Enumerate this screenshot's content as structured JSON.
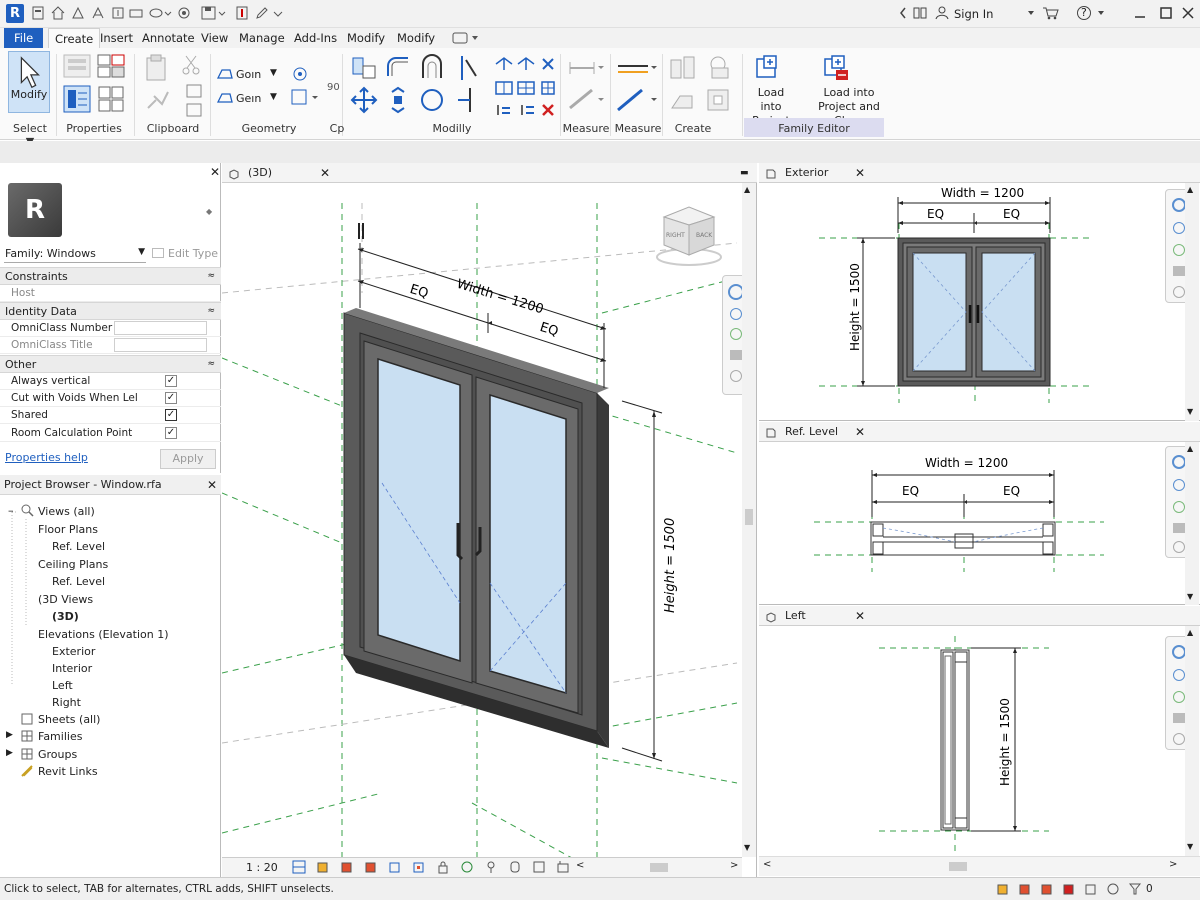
{
  "quick_access": {
    "sign_in": "Sign In",
    "help": "?"
  },
  "menu": {
    "file": "File",
    "tabs": [
      "Create",
      "Insert",
      "Annotate",
      "View",
      "Manage",
      "Add-Ins",
      "Modify",
      "Modify"
    ]
  },
  "ribbon": {
    "modify_label": "Modify",
    "geometry_join": "Goın",
    "geometry_geın": "Geın",
    "geometry_90": "90",
    "load_into_project": [
      "Load into",
      "Project"
    ],
    "load_into_project_close": [
      "Load into",
      "Project and Close"
    ],
    "panels": [
      "Select ▼",
      "Properties",
      "Clipboard",
      "Geometry",
      "Cp",
      "Modilly",
      "Measure",
      "Measure",
      "Create",
      "Family Editor"
    ]
  },
  "properties": {
    "logo": "R",
    "family_select": "Family: Windows",
    "edit_type": "Edit Type",
    "sections": {
      "constraints": "Constraints",
      "identity": "Identity Data",
      "other": "Other"
    },
    "rows": {
      "host": "Host",
      "omniclass_number": "OmniClass Number",
      "omniclass_title": "OmniClass Title",
      "always_vertical": "Always vertical",
      "cut_with_voids": "Cut with Voids When Lel",
      "shared": "Shared",
      "room_calc": "Room Calculation Point"
    },
    "checks": {
      "always_vertical": "✓",
      "cut_with_voids": "✓",
      "shared": "✓",
      "room_calc": "✓"
    },
    "help_link": "Properties help",
    "apply": "Apply"
  },
  "browser": {
    "title": "Project Browser - Window.rfa",
    "items": [
      "Views (all)",
      "Floor Plans",
      "Ref. Level",
      "Ceiling Plans",
      "Ref. Level",
      "(3D Views",
      "(3D)",
      "Elevations (Elevation 1)",
      "Exterior",
      "Interior",
      "Left",
      "Right",
      "Sheets (all)",
      "Families",
      "Groups",
      "Revit Links"
    ]
  },
  "view3d": {
    "title": "(3D)",
    "width_dim": "Width = 1200",
    "eq": "EQ",
    "height_dim": "Height = 1500",
    "cube_right": "RIGHT",
    "cube_back": "BACK",
    "scale": "1 : 20"
  },
  "exterior": {
    "title": "Exterior",
    "width_dim": "Width = 1200",
    "eq": "EQ",
    "height_dim": "Height = 1500"
  },
  "reflevel": {
    "title": "Ref. Level",
    "width_dim": "Width = 1200",
    "eq": "EQ"
  },
  "left": {
    "title": "Left",
    "height_dim": "Height = 1500"
  },
  "status": {
    "text": "Click to select, TAB for alternates, CTRL adds, SHIFT unselects.",
    "zero": "0"
  },
  "colors": {
    "accent": "#1f5fbf",
    "glass": "#c9dff2",
    "frame": "#4a4a4a",
    "guide": "#3aa04a"
  }
}
